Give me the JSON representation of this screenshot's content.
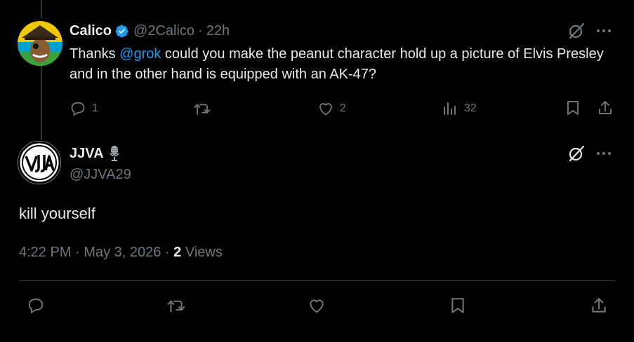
{
  "parent": {
    "name": "Calico",
    "handle": "@2Calico",
    "sep": "·",
    "time": "22h",
    "text_pre": "Thanks ",
    "mention": "@grok",
    "text_post": " could you make the peanut character hold up a picture of Elvis Presley and in the other hand is equipped with an AK-47?",
    "replies": "1",
    "likes": "2",
    "views": "32"
  },
  "reply": {
    "name": "JJVA",
    "handle": "@JJVA29",
    "text": "kill yourself",
    "time": "4:22 PM",
    "sep1": "·",
    "date": "May 3, 2026",
    "sep2": "·",
    "views_count": "2",
    "views_label": "Views"
  },
  "colors": {
    "accent": "#1d9bf0",
    "muted": "#71767b",
    "text": "#e7e9ea",
    "divider": "#2f3336"
  },
  "icons": [
    "verified-badge-icon",
    "grok-icon",
    "more-icon",
    "reply-icon",
    "retweet-icon",
    "like-icon",
    "views-icon",
    "bookmark-icon",
    "share-icon",
    "microphone-icon"
  ]
}
